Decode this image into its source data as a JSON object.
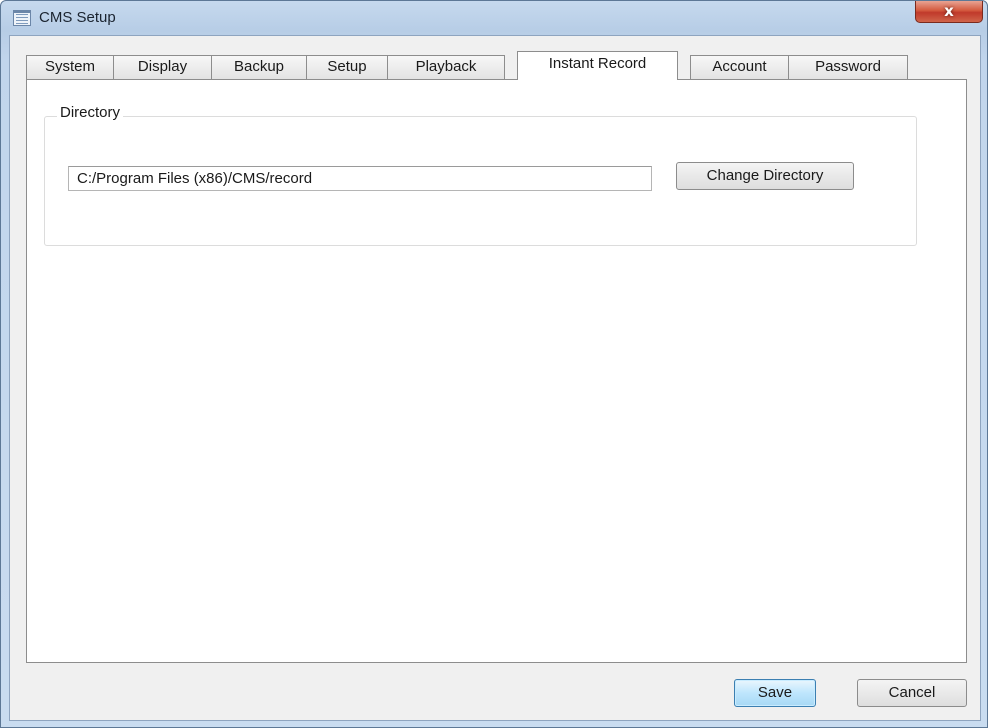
{
  "window": {
    "title": "CMS Setup",
    "close_label": "x",
    "app_icon": "window-list-icon",
    "close_icon": "close-icon"
  },
  "tabs": [
    {
      "label": "System"
    },
    {
      "label": "Display"
    },
    {
      "label": "Backup"
    },
    {
      "label": "Setup"
    },
    {
      "label": "Playback"
    },
    {
      "label": "Instant Record",
      "active": true
    },
    {
      "label": "Account"
    },
    {
      "label": "Password"
    }
  ],
  "directory": {
    "group_label": "Directory",
    "path_value": "C:/Program Files (x86)/CMS/record",
    "change_label": "Change Directory"
  },
  "buttons": {
    "save_label": "Save",
    "cancel_label": "Cancel"
  },
  "colors": {
    "save_button_accent": "#bee6fd",
    "close_button": "#c0392b"
  }
}
